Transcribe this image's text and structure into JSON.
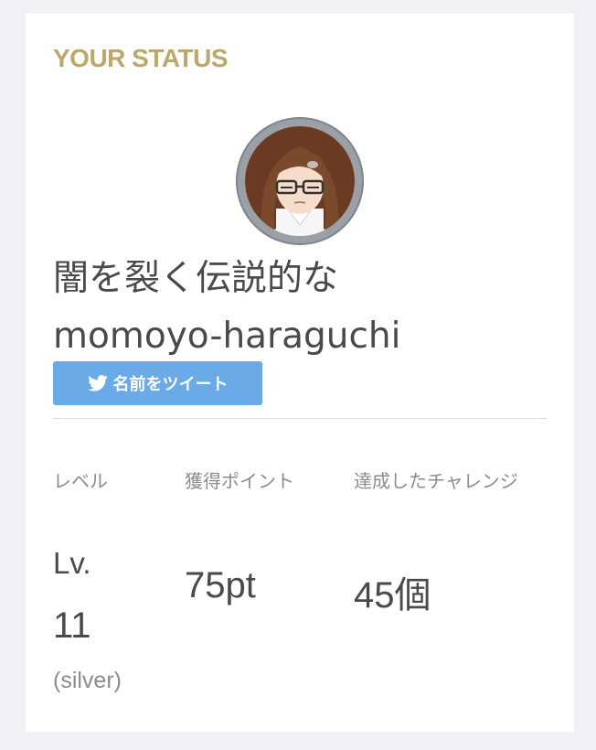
{
  "status": {
    "section_title": "YOUR STATUS",
    "avatar_alt": "",
    "name_line1": "闇を裂く伝説的な",
    "name_line2": "momoyo-haraguchi",
    "tweet_button_label": "名前をツイート",
    "stats": {
      "level": {
        "label": "レベル",
        "prefix": "Lv.",
        "value": "11",
        "rank": "(silver)"
      },
      "points": {
        "label": "獲得ポイント",
        "value": "75pt"
      },
      "challenges": {
        "label": "達成したチャレンジ",
        "value": "45個"
      }
    }
  },
  "colors": {
    "page_background": "#f0f0f5",
    "card_background": "#ffffff",
    "section_title": "#bca86a",
    "tweet_button": "#69aae7",
    "muted_text": "#8c8c8c",
    "main_text": "#4a4a4a"
  },
  "icons": {
    "tweet_button_icon": "twitter-bird-icon"
  }
}
